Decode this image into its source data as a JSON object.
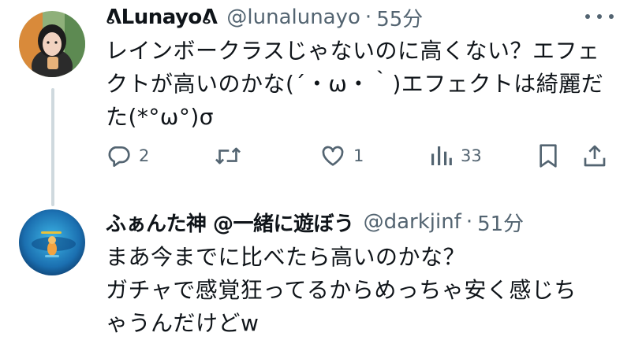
{
  "tweets": [
    {
      "display_name": "ᕕLunayoᕕ",
      "handle": "@lunalunayo",
      "separator": "·",
      "time": "55分",
      "lines": [
        "レインボークラスじゃないのに高くない？エフェ",
        "クトが高いのかな(´・ω・｀)エフェクトは綺麗だ",
        "た(*°ω°)σ"
      ],
      "metrics": {
        "replies": "2",
        "likes": "1",
        "views": "33"
      },
      "icons": [
        "reply-icon",
        "retweet-icon",
        "like-icon",
        "views-icon",
        "bookmark-icon",
        "share-icon"
      ]
    },
    {
      "display_name": "ふぁんた神 @一緒に遊ぼう",
      "handle": "@darkjinf",
      "separator": "·",
      "time": "51分",
      "lines": [
        "まあ今までに比べたら高いのかな？",
        "ガチャで感覚狂ってるからめっちゃ安く感じち",
        "ゃうんだけどw"
      ]
    }
  ],
  "colors": {
    "text": "#0f1419",
    "muted": "#536471",
    "thread_line": "#cfd9de"
  }
}
